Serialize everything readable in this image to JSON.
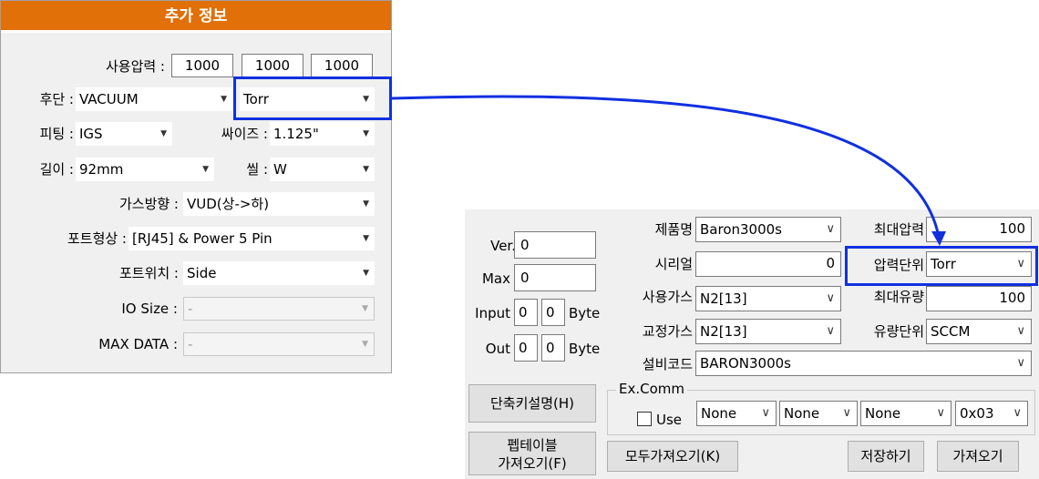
{
  "left": {
    "header": "추가 정보",
    "pressure_label": "사용압력 :",
    "pressure_values": [
      "1000",
      "1000",
      "1000"
    ],
    "end_label": "후단 :",
    "end_value": "VACUUM",
    "unit_value": "Torr",
    "fitting_label": "피팅 :",
    "fitting_value": "IGS",
    "size_label": "싸이즈 :",
    "size_value": "1.125\"",
    "length_label": "길이 :",
    "length_value": "92mm",
    "seal_label": "씰 :",
    "seal_value": "W",
    "gas_dir_label": "가스방향 :",
    "gas_dir_value": "VUD(상->하)",
    "port_shape_label": "포트형상 :",
    "port_shape_value": "[RJ45] & Power 5 Pin",
    "port_pos_label": "포트위치 :",
    "port_pos_value": "Side",
    "io_size_label": "IO Size :",
    "io_size_value": "-",
    "max_data_label": "MAX DATA :",
    "max_data_value": "-"
  },
  "right": {
    "ver_label": "Ver.",
    "ver_value": "0",
    "max_label": "Max",
    "max_value": "0",
    "input_label": "Input",
    "input_values": [
      "0",
      "0"
    ],
    "out_label": "Out",
    "out_values": [
      "0",
      "0"
    ],
    "byte_label": "Byte",
    "product_label": "제품명",
    "product_value": "Baron3000s",
    "max_pressure_label": "최대압력",
    "max_pressure_value": "100",
    "serial_label": "시리얼",
    "serial_value": "0",
    "pressure_unit_label": "압력단위",
    "pressure_unit_value": "Torr",
    "use_gas_label": "사용가스",
    "use_gas_value": "N2[13]",
    "max_flow_label": "최대유량",
    "max_flow_value": "100",
    "cal_gas_label": "교정가스",
    "cal_gas_value": "N2[13]",
    "flow_unit_label": "유량단위",
    "flow_unit_value": "SCCM",
    "equip_code_label": "설비코드",
    "equip_code_value": "BARON3000s",
    "excomm_label": "Ex.Comm",
    "use_label": "Use",
    "excomm_values": [
      "None",
      "None",
      "None",
      "0x03"
    ],
    "shortcut_button": "단축키설명(H)",
    "table_button_line1": "펩테이블",
    "table_button_line2": "가져오기(F)",
    "fetch_all_button": "모두가져오기(K)",
    "save_button": "저장하기",
    "fetch_button": "가져오기"
  },
  "colors": {
    "header_orange": "#e07007",
    "highlight_blue": "#1030e0"
  },
  "icons": {
    "dropdown": "dropdown-arrow-icon",
    "chevron": "chevron-down-icon"
  }
}
